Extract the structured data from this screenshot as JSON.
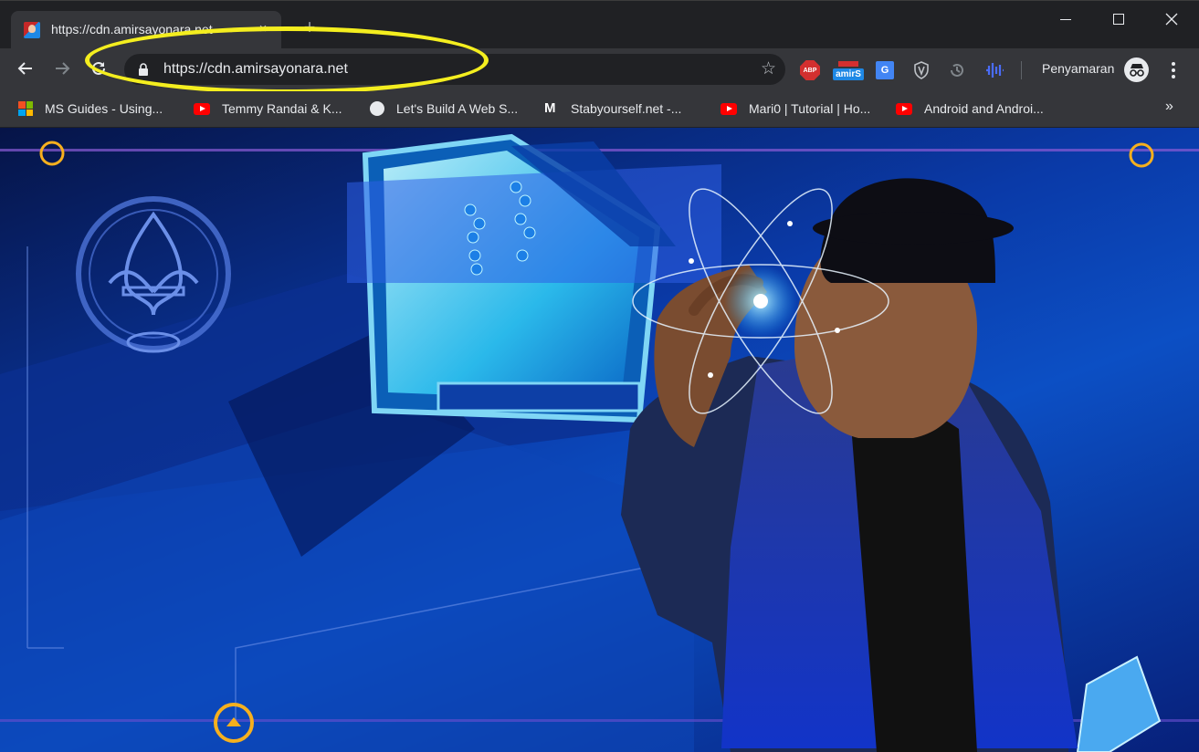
{
  "tab": {
    "title": "https://cdn.amirsayonara.net",
    "close": "×",
    "new_tab": "+"
  },
  "toolbar": {
    "url": "https://cdn.amirsayonara.net",
    "profile_label": "Penyamaran",
    "extensions": [
      {
        "name": "adblock-plus",
        "label": "ABP"
      },
      {
        "name": "amirs",
        "label": "amirS"
      },
      {
        "name": "google-translate",
        "label": "G"
      }
    ]
  },
  "bookmarks": {
    "items": [
      {
        "label": "MS Guides - Using...",
        "icon": "microsoft-icon"
      },
      {
        "label": "Temmy Randai & K...",
        "icon": "youtube-icon"
      },
      {
        "label": "Let's Build A Web S...",
        "icon": "globe-icon"
      },
      {
        "label": "Stabyourself.net -...",
        "icon": "m-logo-icon"
      },
      {
        "label": "Mari0 | Tutorial | Ho...",
        "icon": "youtube-icon"
      },
      {
        "label": "Android and Androi...",
        "icon": "youtube-icon"
      }
    ],
    "more": "»"
  },
  "colors": {
    "highlight": "#f4ee1f",
    "youtube": "#ff0000",
    "abp": "#d32f2f",
    "amirs": "#1e88e5"
  }
}
